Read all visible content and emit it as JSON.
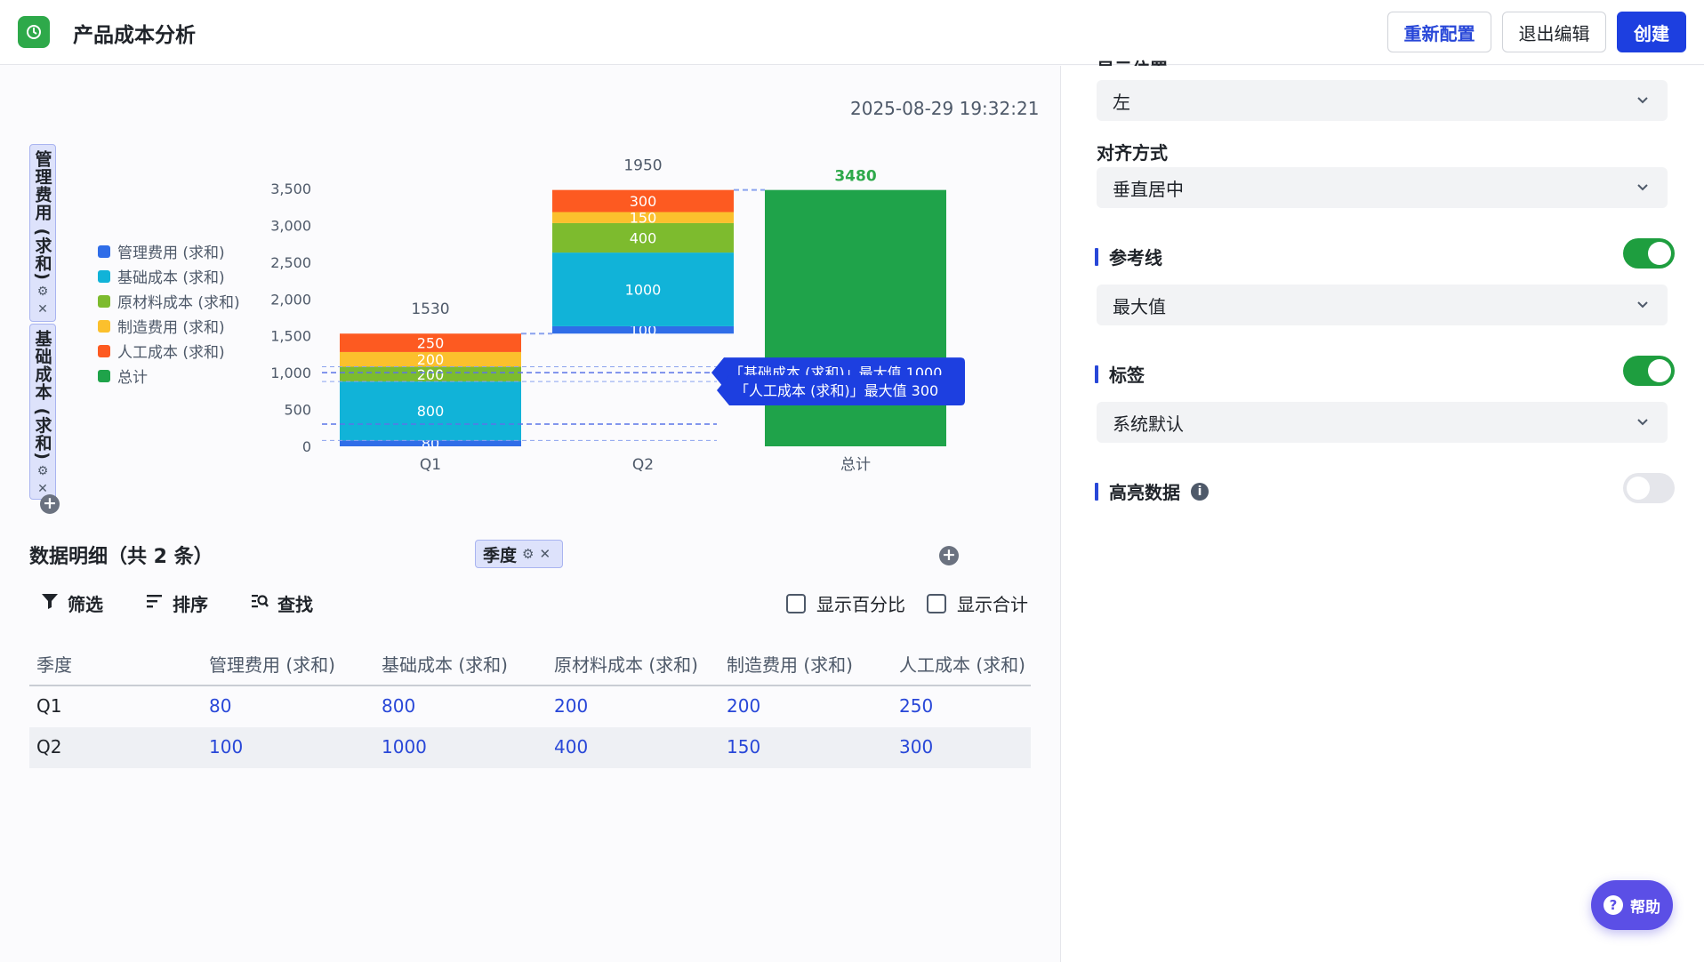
{
  "header": {
    "title": "产品成本分析",
    "reconfig_label": "重新配置",
    "exit_label": "退出编辑",
    "create_label": "创建"
  },
  "chart_area": {
    "timestamp": "2025-08-29 19:32:21",
    "y_field_pills": [
      {
        "label": "管理费用 (求和)"
      },
      {
        "label": "基础成本 (求和)"
      }
    ],
    "x_field_pill": "季度"
  },
  "chart_data": {
    "type": "bar",
    "subtype": "stacked waterfall",
    "categories": [
      "Q1",
      "Q2",
      "总计"
    ],
    "legend": [
      "管理费用 (求和)",
      "基础成本 (求和)",
      "原材料成本 (求和)",
      "制造费用 (求和)",
      "人工成本 (求和)",
      "总计"
    ],
    "legend_position": "left",
    "series": [
      {
        "name": "管理费用 (求和)",
        "color": "#2f6de8",
        "values": [
          80,
          100,
          null
        ]
      },
      {
        "name": "基础成本 (求和)",
        "color": "#11b3d8",
        "values": [
          800,
          1000,
          null
        ]
      },
      {
        "name": "原材料成本 (求和)",
        "color": "#7dbb2e",
        "values": [
          200,
          400,
          null
        ]
      },
      {
        "name": "制造费用 (求和)",
        "color": "#fbc02d",
        "values": [
          200,
          150,
          null
        ]
      },
      {
        "name": "人工成本 (求和)",
        "color": "#fd5a21",
        "values": [
          250,
          300,
          null
        ]
      },
      {
        "name": "总计",
        "color": "#1fa34a",
        "values": [
          null,
          null,
          3480
        ]
      }
    ],
    "stack_totals": [
      1530,
      1950,
      3480
    ],
    "ylim": [
      0,
      3500
    ],
    "yticks": [
      "0",
      "500",
      "1,000",
      "1,500",
      "2,000",
      "2,500",
      "3,000",
      "3,500"
    ],
    "reference_lines": [
      {
        "label": "「基础成本 (求和)」最大值 1000",
        "value": 1000
      },
      {
        "label": "「人工成本 (求和)」最大值 300",
        "value": 300
      }
    ]
  },
  "detail": {
    "title": "数据明细（共 2 条）",
    "toolbar": {
      "filter": "筛选",
      "sort": "排序",
      "find": "查找"
    },
    "checks": {
      "percent": "显示百分比",
      "total": "显示合计"
    },
    "columns": [
      "季度",
      "管理费用 (求和)",
      "基础成本 (求和)",
      "原材料成本 (求和)",
      "制造费用 (求和)",
      "人工成本 (求和)"
    ],
    "rows": [
      [
        "Q1",
        "80",
        "800",
        "200",
        "200",
        "250"
      ],
      [
        "Q2",
        "100",
        "1000",
        "400",
        "150",
        "300"
      ]
    ]
  },
  "panel": {
    "cut_label": "显示位置",
    "position_value": "左",
    "align_label": "对齐方式",
    "align_value": "垂直居中",
    "refline_label": "参考线",
    "refline_on": true,
    "refline_value": "最大值",
    "tag_label": "标签",
    "tag_on": true,
    "tag_value": "系统默认",
    "highlight_label": "高亮数据",
    "highlight_on": false
  },
  "help_label": "帮助"
}
